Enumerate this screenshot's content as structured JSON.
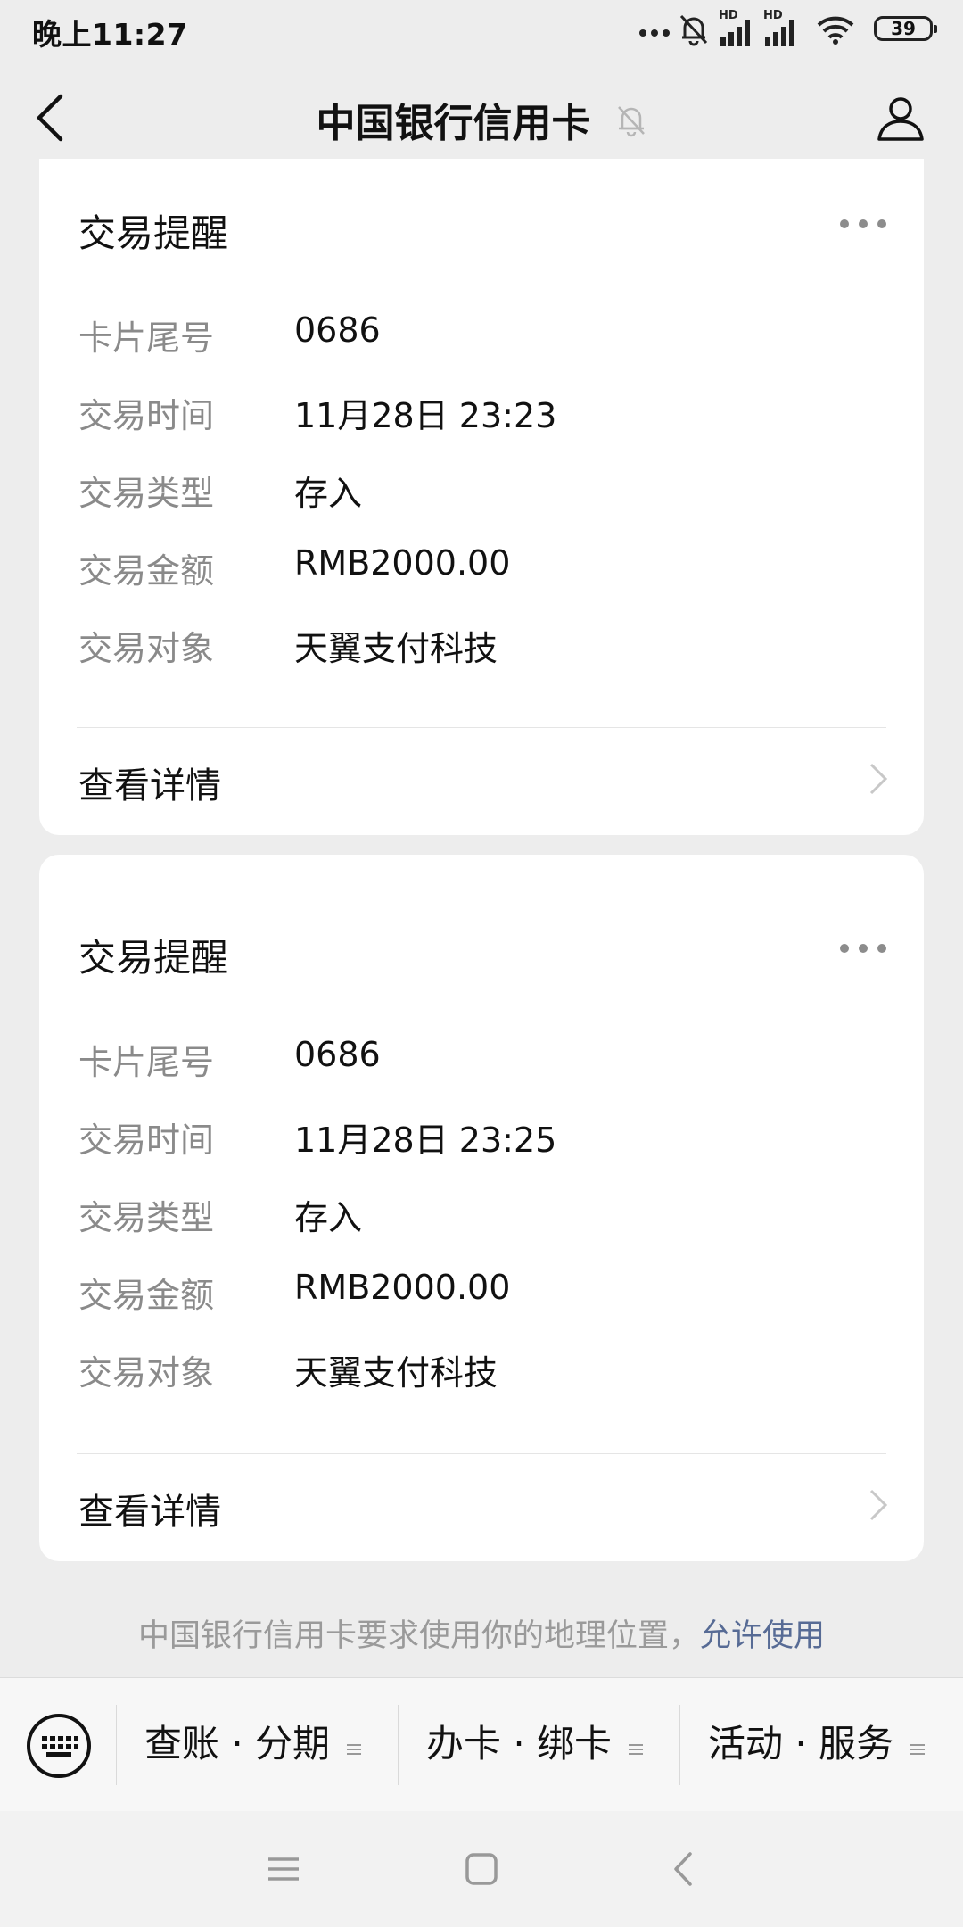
{
  "status_bar": {
    "time": "晚上11:27",
    "signal_tag_1": "HD",
    "signal_tag_2": "HD",
    "battery": "39"
  },
  "nav": {
    "title": "中国银行信用卡",
    "icons": [
      "back-arrow-icon",
      "bell-muted-icon",
      "profile-icon"
    ]
  },
  "cards": [
    {
      "title": "交易提醒",
      "fields": [
        {
          "label": "卡片尾号",
          "value": "0686"
        },
        {
          "label": "交易时间",
          "value": "11月28日 23:23"
        },
        {
          "label": "交易类型",
          "value": "存入"
        },
        {
          "label": "交易金额",
          "value": "RMB2000.00"
        },
        {
          "label": "交易对象",
          "value": "天翼支付科技"
        }
      ],
      "detail_label": "查看详情"
    },
    {
      "title": "交易提醒",
      "fields": [
        {
          "label": "卡片尾号",
          "value": "0686"
        },
        {
          "label": "交易时间",
          "value": "11月28日 23:25"
        },
        {
          "label": "交易类型",
          "value": "存入"
        },
        {
          "label": "交易金额",
          "value": "RMB2000.00"
        },
        {
          "label": "交易对象",
          "value": "天翼支付科技"
        }
      ],
      "detail_label": "查看详情"
    }
  ],
  "location_notice": {
    "text": "中国银行信用卡要求使用你的地理位置，",
    "action": "允许使用"
  },
  "menu": {
    "items": [
      {
        "label": "查账 · 分期"
      },
      {
        "label": "办卡 · 绑卡"
      },
      {
        "label": "活动 · 服务"
      }
    ]
  },
  "colors": {
    "background": "#ededed",
    "card": "#ffffff",
    "label_gray": "#8a8a8a",
    "link_blue": "#576b95"
  }
}
